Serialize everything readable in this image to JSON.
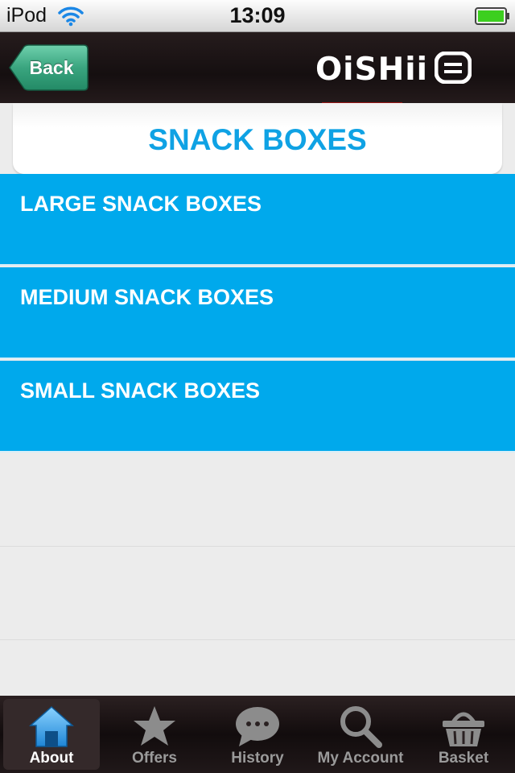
{
  "status_bar": {
    "carrier": "iPod",
    "time": "13:09",
    "wifi_icon": "wifi-icon",
    "battery_icon": "battery-icon",
    "battery_color": "#3ccf1f",
    "battery_level": 1.0
  },
  "nav_bar": {
    "back_label": "Back",
    "back_icon": "back-arrow-button",
    "logo_text": "OiSHii",
    "logo_mark": "bento-box-icon",
    "back_color": "#3aa57f"
  },
  "page": {
    "title": "SNACK BOXES",
    "accent_color": "#0fa2e4"
  },
  "categories": [
    {
      "label": "LARGE SNACK BOXES"
    },
    {
      "label": "MEDIUM SNACK BOXES"
    },
    {
      "label": "SMALL SNACK BOXES"
    }
  ],
  "list_color": "#00a9ec",
  "tab_bar": {
    "tabs": [
      {
        "label": "About",
        "icon": "home-icon",
        "active": true
      },
      {
        "label": "Offers",
        "icon": "star-icon",
        "active": false
      },
      {
        "label": "History",
        "icon": "chat-bubble-icon",
        "active": false
      },
      {
        "label": "My Account",
        "icon": "search-icon",
        "active": false
      },
      {
        "label": "Basket",
        "icon": "basket-icon",
        "active": false
      }
    ],
    "active_color": "#3aa9e8"
  }
}
